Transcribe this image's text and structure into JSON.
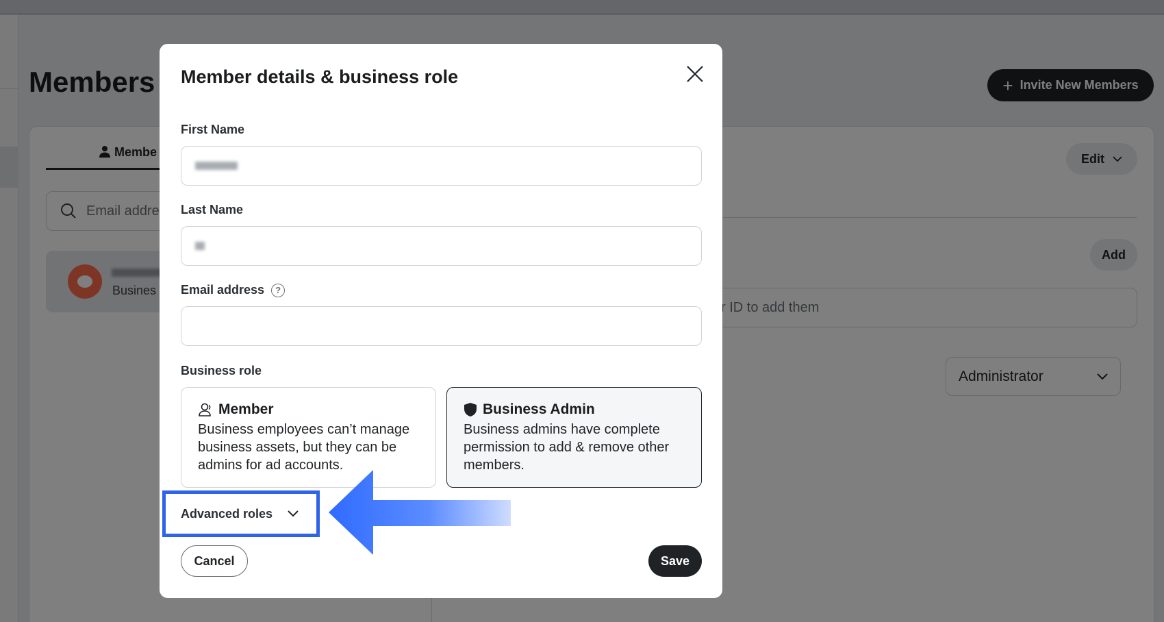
{
  "page": {
    "title": "Members",
    "invite_button": "Invite New Members",
    "tab_members": "Membe",
    "search_placeholder": "Email addre",
    "member_row_sub": "Busines",
    "edit_button": "Edit",
    "add_button": "Add",
    "add_input_placeholder": "r ID to add them",
    "role_select_value": "Administrator"
  },
  "modal": {
    "title": "Member details & business role",
    "first_name_label": "First Name",
    "last_name_label": "Last Name",
    "email_label": "Email address",
    "email_help_icon": "?",
    "business_role_label": "Business role",
    "roles": [
      {
        "title": "Member",
        "description": "Business employees can’t manage business assets, but they can be admins for ad accounts.",
        "icon": "person-group-icon",
        "selected": false
      },
      {
        "title": "Business Admin",
        "description": "Business admins have complete permission to add & remove other members.",
        "icon": "shield-icon",
        "selected": true
      }
    ],
    "advanced_roles": "Advanced roles",
    "cancel_button": "Cancel",
    "save_button": "Save"
  },
  "colors": {
    "highlight": "#2f63e8",
    "primary_dark": "#1f2326"
  }
}
